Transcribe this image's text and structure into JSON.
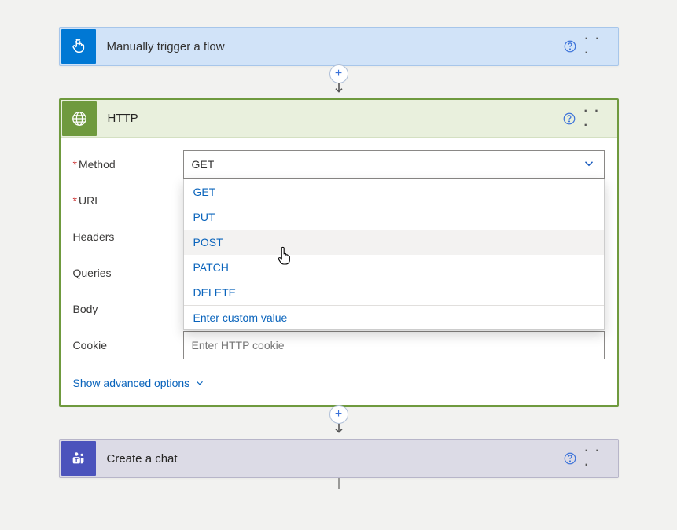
{
  "trigger": {
    "title": "Manually trigger a flow",
    "icon_name": "touch-icon"
  },
  "http": {
    "title": "HTTP",
    "icon_name": "globe-icon",
    "fields": {
      "method_label": "Method",
      "uri_label": "URI",
      "headers_label": "Headers",
      "queries_label": "Queries",
      "body_label": "Body",
      "cookie_label": "Cookie",
      "cookie_placeholder": "Enter HTTP cookie"
    },
    "method_selected": "GET",
    "method_options": [
      "GET",
      "PUT",
      "POST",
      "PATCH",
      "DELETE"
    ],
    "method_custom_label": "Enter custom value",
    "advanced_label": "Show advanced options"
  },
  "chat": {
    "title": "Create a chat",
    "icon_name": "teams-icon"
  },
  "colors": {
    "trigger_accent": "#0078d4",
    "http_accent": "#6f9a3e",
    "chat_accent": "#4b53bc",
    "link": "#0a64bc"
  }
}
